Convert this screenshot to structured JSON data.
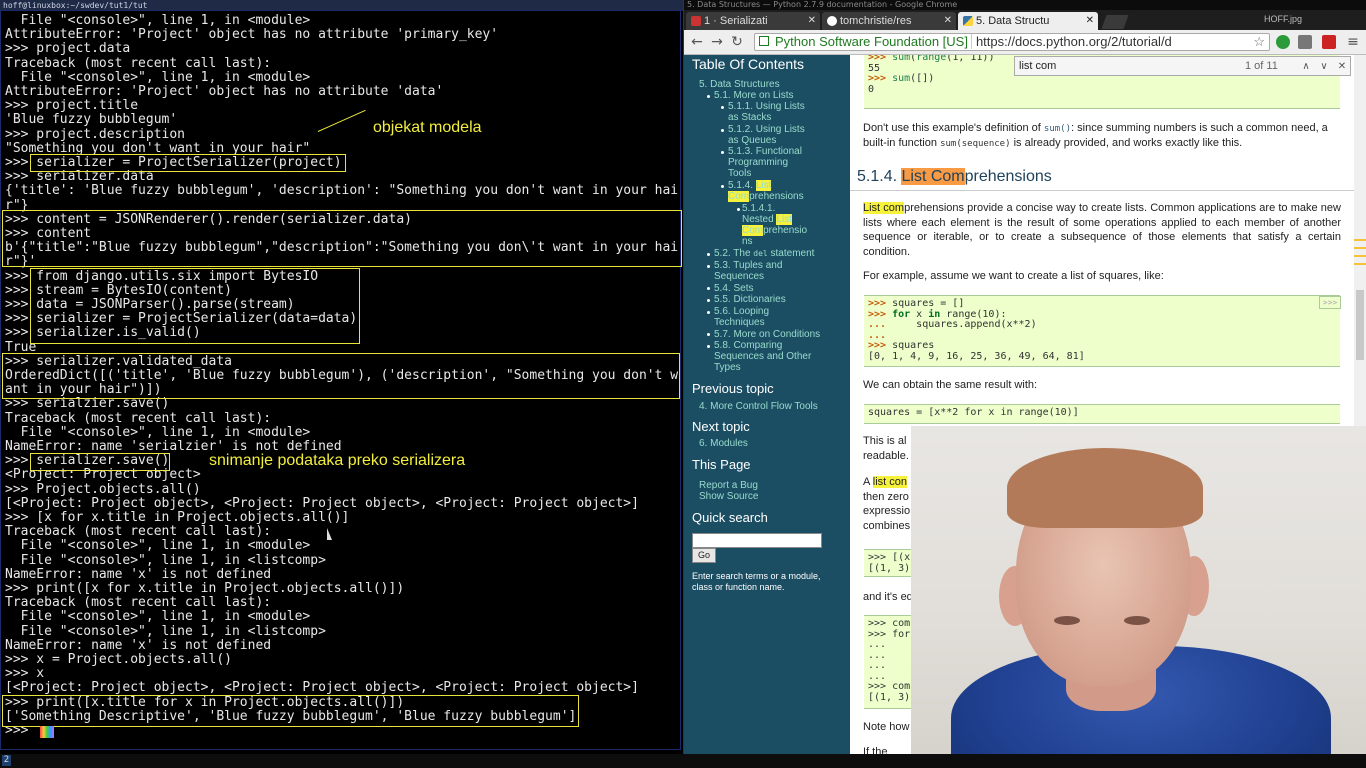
{
  "terminal": {
    "title": "hoff@linuxbox:~/swdev/tut1/tut",
    "lines": [
      "  File \"<console>\", line 1, in <module>",
      "AttributeError: 'Project' object has no attribute 'primary_key'",
      ">>> project.data",
      "Traceback (most recent call last):",
      "  File \"<console>\", line 1, in <module>",
      "AttributeError: 'Project' object has no attribute 'data'",
      ">>> project.title",
      "'Blue fuzzy bubblegum'",
      ">>> project.description",
      "\"Something you don't want in your hair\"",
      ">>> serializer = ProjectSerializer(project)",
      ">>> serializer.data",
      "{'title': 'Blue fuzzy bubblegum', 'description': \"Something you don't want in your hai",
      "r\"}",
      ">>> content = JSONRenderer().render(serializer.data)",
      ">>> content",
      "b'{\"title\":\"Blue fuzzy bubblegum\",\"description\":\"Something you don\\'t want in your hai",
      "r\"}'",
      ">>> from django.utils.six import BytesIO",
      ">>> stream = BytesIO(content)",
      ">>> data = JSONParser().parse(stream)",
      ">>> serializer = ProjectSerializer(data=data)",
      ">>> serializer.is_valid()",
      "True",
      ">>> serializer.validated_data",
      "OrderedDict([('title', 'Blue fuzzy bubblegum'), ('description', \"Something you don't w",
      "ant in your hair\")])",
      ">>> serialzier.save()",
      "Traceback (most recent call last):",
      "  File \"<console>\", line 1, in <module>",
      "NameError: name 'serialzier' is not defined",
      ">>> serializer.save()",
      "<Project: Project object>",
      ">>> Project.objects.all()",
      "[<Project: Project object>, <Project: Project object>, <Project: Project object>]",
      ">>> [x for x.title in Project.objects.all()]",
      "Traceback (most recent call last):",
      "  File \"<console>\", line 1, in <module>",
      "  File \"<console>\", line 1, in <listcomp>",
      "NameError: name 'x' is not defined",
      ">>> print([x for x.title in Project.objects.all()])",
      "Traceback (most recent call last):",
      "  File \"<console>\", line 1, in <module>",
      "  File \"<console>\", line 1, in <listcomp>",
      "NameError: name 'x' is not defined",
      ">>> x = Project.objects.all()",
      ">>> x",
      "[<Project: Project object>, <Project: Project object>, <Project: Project object>]",
      ">>> print([x.title for x in Project.objects.all()])",
      "['Something Descriptive', 'Blue fuzzy bubblegum', 'Blue fuzzy bubblegum']",
      ">>> "
    ],
    "annotations": {
      "model_object": "objekat modela",
      "save_note": "snimanje podataka preko serializera"
    }
  },
  "status_bar": {
    "workspace": "2"
  },
  "browser": {
    "window_title": "5. Data Structures — Python 2.7.9 documentation - Google Chrome",
    "tabs": [
      {
        "label": "1 · Serializati",
        "icon": "python-icon"
      },
      {
        "label": "tomchristie/res",
        "icon": "github-icon"
      },
      {
        "label": "5. Data Structu",
        "icon": "python-icon"
      }
    ],
    "profile": "HOFF.jpg",
    "ev_badge": "Python Software Foundation [US]",
    "url": "https://docs.python.org/2/tutorial/d",
    "find": {
      "query": "list com",
      "count": "1 of 11"
    },
    "sidebar": {
      "toc_title": "Table Of Contents",
      "toc": [
        "5. Data Structures",
        "5.1. More on Lists",
        "5.1.1. Using Lists",
        "as Stacks",
        "5.1.2. Using Lists",
        "as Queues",
        "5.1.3. Functional",
        "Programming",
        "Tools",
        "5.1.4.",
        "List",
        "Com",
        "prehensions",
        "5.1.4.1.",
        "Nested",
        "List",
        "Com",
        "prehensio",
        "ns",
        "5.2. The",
        "del",
        "statement",
        "5.3. Tuples and",
        "Sequences",
        "5.4. Sets",
        "5.5. Dictionaries",
        "5.6. Looping",
        "Techniques",
        "5.7. More on Conditions",
        "5.8. Comparing",
        "Sequences and Other",
        "Types"
      ],
      "prev_title": "Previous topic",
      "prev_link": "4. More Control Flow Tools",
      "next_title": "Next topic",
      "next_link": "6. Modules",
      "this_page_title": "This Page",
      "report_bug": "Report a Bug",
      "show_source": "Show Source",
      "quick_search_title": "Quick search",
      "go_label": "Go",
      "search_hint": "Enter search terms or a module, class or function name."
    },
    "content": {
      "pre1": [
        ">>> sum(range(1, 11))",
        "55",
        ">>> sum([])",
        "0"
      ],
      "para1_a": "Don't use this example's definition of",
      "para1_code": "sum()",
      "para1_b": ": since summing numbers is such a common need, a built-in function",
      "para1_code2": "sum(sequence)",
      "para1_c": "is already provided, and works exactly like this.",
      "section_number": "5.1.4.",
      "section_hl": "List Com",
      "section_rest": "prehensions",
      "para2_hl": "List com",
      "para2": "prehensions provide a concise way to create lists. Common applications are to make new lists where each element is the result of some operations applied to each member of another sequence or iterable, or to create a subsequence of those elements that satisfy a certain condition.",
      "para3": "For example, assume we want to create a list of squares, like:",
      "pre2_l1": "squares = []",
      "pre2_l2a": "for",
      "pre2_l2b": " x ",
      "pre2_l2c": "in",
      "pre2_l2d": " range(10):",
      "pre2_l3": "    squares.append(x**2)",
      "pre2_l5": "squares",
      "pre2_l6": "[0, 1, 4, 9, 16, 25, 36, 49, 64, 81]",
      "pre2_copy": ">>>",
      "para4": "We can obtain the same result with:",
      "pre3": "squares = [x**2 for x in range(10)]",
      "para5a": "This is al",
      "para5b": "readable.",
      "para6a": "A ",
      "para6_hl": "list con",
      "para6b": "then zero",
      "para6c": "expressio",
      "para6d": "combines",
      "pre4_l1": ">>> [(x,",
      "pre4_l2": "[(1, 3),",
      "para7": "and it's eq",
      "pre5": [
        ">>> comb",
        ">>> for",
        "...",
        "...",
        "...",
        "...",
        ">>> comb",
        "[(1, 3),"
      ],
      "para8": "Note how",
      "para9": "If the"
    }
  },
  "colors": {
    "annotation": "#f2ee3c",
    "sidebar_bg": "#1c4e63",
    "code_bg": "#eeffcc",
    "highlight": "#f6f13a",
    "current_match": "#f99b45"
  }
}
